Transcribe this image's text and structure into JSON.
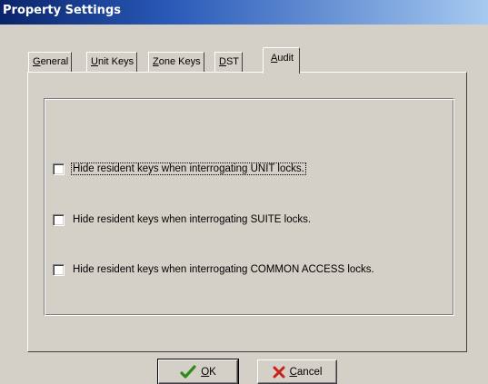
{
  "window": {
    "title": "Property Settings"
  },
  "tabs": [
    {
      "prefix": "",
      "accel": "G",
      "rest": "eneral",
      "active": false
    },
    {
      "prefix": "",
      "accel": "U",
      "rest": "nit Keys",
      "active": false
    },
    {
      "prefix": "",
      "accel": "Z",
      "rest": "one Keys",
      "active": false
    },
    {
      "prefix": "",
      "accel": "D",
      "rest": "ST",
      "active": false
    },
    {
      "prefix": "",
      "accel": "A",
      "rest": "udit",
      "active": true
    }
  ],
  "audit": {
    "options": [
      {
        "label": "Hide resident keys when interrogating UNIT locks.",
        "checked": false,
        "focused": true
      },
      {
        "label": "Hide resident keys when interrogating SUITE locks.",
        "checked": false,
        "focused": false
      },
      {
        "label": "Hide resident keys when interrogating COMMON ACCESS locks.",
        "checked": false,
        "focused": false
      }
    ]
  },
  "buttons": {
    "ok": {
      "accel": "O",
      "rest": "K",
      "icon": "checkmark-icon",
      "color": "#2e8b1a"
    },
    "cancel": {
      "accel": "C",
      "rest": "ancel",
      "icon": "x-icon",
      "color": "#c8201a"
    }
  }
}
